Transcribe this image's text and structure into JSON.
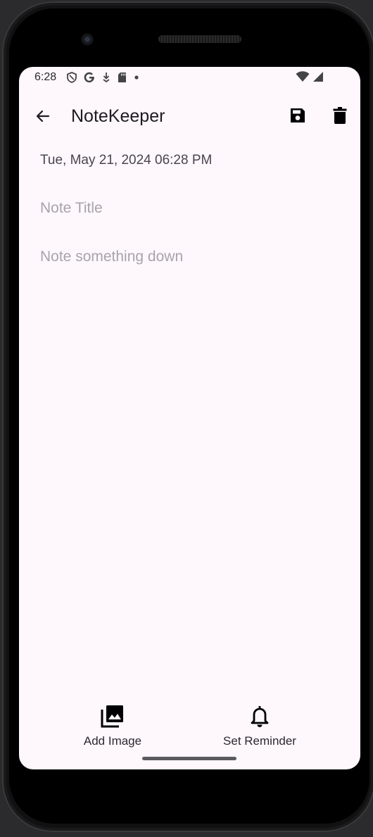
{
  "status_bar": {
    "time": "6:28",
    "icons": [
      "shield-icon",
      "google-g-icon",
      "download-icon",
      "sd-card-icon",
      "dot-icon"
    ],
    "right_icons": [
      "wifi-icon",
      "cell-signal-icon"
    ]
  },
  "app_bar": {
    "title": "NoteKeeper",
    "back_icon": "arrow-back-icon",
    "save_icon": "save-icon",
    "delete_icon": "delete-icon"
  },
  "note": {
    "date_time": "Tue, May 21, 2024 06:28 PM",
    "title_value": "",
    "title_placeholder": "Note Title",
    "body_value": "",
    "body_placeholder": "Note something down"
  },
  "bottom_actions": {
    "add_image": {
      "label": "Add Image",
      "icon": "photo-library-icon"
    },
    "set_reminder": {
      "label": "Set Reminder",
      "icon": "bell-icon"
    }
  },
  "colors": {
    "background": "#fef7fb",
    "text_primary": "#1d1b20",
    "text_secondary": "#49454f",
    "placeholder": "#a7a4ab"
  }
}
